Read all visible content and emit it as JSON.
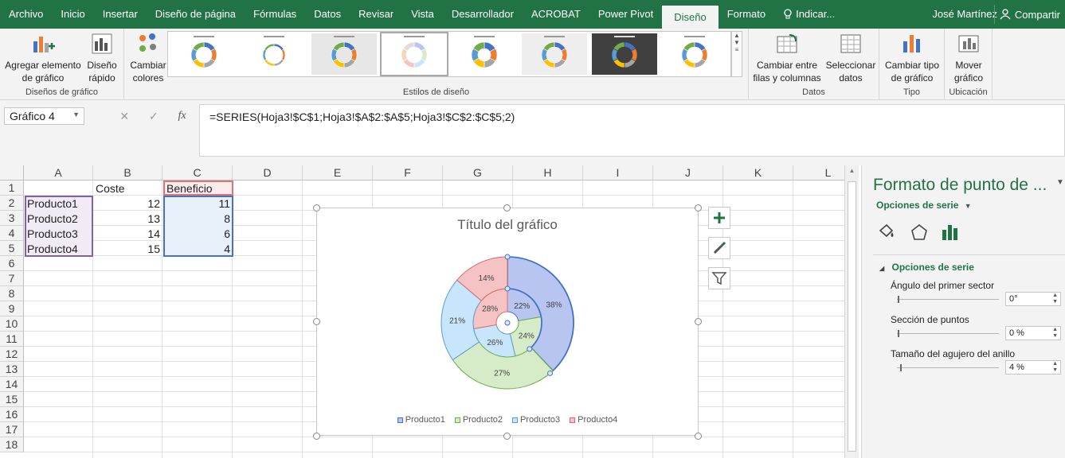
{
  "ribbon_tabs": [
    "Archivo",
    "Inicio",
    "Insertar",
    "Diseño de página",
    "Fórmulas",
    "Datos",
    "Revisar",
    "Vista",
    "Desarrollador",
    "ACROBAT",
    "Power Pivot",
    "Diseño",
    "Formato"
  ],
  "tell_me": "Indicar...",
  "user_name": "José Martínez",
  "share_label": "Compartir",
  "ribbon": {
    "add_element": "Agregar elemento",
    "add_element_2": "de gráfico",
    "quick_layout": "Diseño",
    "quick_layout_2": "rápido",
    "change_colors": "Cambiar",
    "change_colors_2": "colores",
    "group_layouts": "Diseños de gráfico",
    "group_styles": "Estilos de diseño",
    "switch_rows": "Cambiar entre",
    "switch_rows_2": "filas y columnas",
    "select_data": "Seleccionar",
    "select_data_2": "datos",
    "group_data": "Datos",
    "change_type": "Cambiar tipo",
    "change_type_2": "de gráfico",
    "group_type": "Tipo",
    "move_chart": "Mover",
    "move_chart_2": "gráfico",
    "group_location": "Ubicación"
  },
  "formula_bar": {
    "name_box": "Gráfico 4",
    "fx": "fx",
    "formula": "=SERIES(Hoja3!$C$1;Hoja3!$A$2:$A$5;Hoja3!$C$2:$C$5;2)"
  },
  "sheet": {
    "columns": [
      "A",
      "B",
      "C",
      "D",
      "E",
      "F",
      "G",
      "H",
      "I",
      "J",
      "K",
      "L"
    ],
    "rows": [
      "1",
      "2",
      "3",
      "4",
      "5",
      "6",
      "7",
      "8",
      "9",
      "10",
      "11",
      "12",
      "13",
      "14",
      "15",
      "16",
      "17",
      "18"
    ],
    "headers": {
      "B1": "Coste",
      "C1": "Beneficio"
    },
    "data": [
      {
        "a": "Producto1",
        "b": "12",
        "c": "11"
      },
      {
        "a": "Producto2",
        "b": "13",
        "c": "8"
      },
      {
        "a": "Producto3",
        "b": "14",
        "c": "6"
      },
      {
        "a": "Producto4",
        "b": "15",
        "c": "4"
      }
    ]
  },
  "chart_data": {
    "type": "doughnut",
    "title": "Título del gráfico",
    "categories": [
      "Producto1",
      "Producto2",
      "Producto3",
      "Producto4"
    ],
    "colors": [
      "#b7c5f0",
      "#d6ecc8",
      "#c8e6fb",
      "#f5c3c3"
    ],
    "strokes": [
      "#4472c4",
      "#70ad47",
      "#5b9bd5",
      "#e06666"
    ],
    "series": [
      {
        "name": "Coste",
        "values": [
          12,
          13,
          14,
          15
        ],
        "labels": [
          "22%",
          "24%",
          "26%",
          "28%"
        ]
      },
      {
        "name": "Beneficio",
        "values": [
          11,
          8,
          6,
          4
        ],
        "labels": [
          "38%",
          "27%",
          "21%",
          "14%"
        ]
      }
    ],
    "legend": "bottom"
  },
  "pane": {
    "title": "Formato de punto de ...",
    "series_options": "Opciones de serie",
    "section": "Opciones de serie",
    "angle_label": "Ángulo del primer sector",
    "angle_value": "0°",
    "explosion_label": "Sección de puntos",
    "explosion_value": "0 %",
    "hole_label": "Tamaño del agujero del anillo",
    "hole_value": "4 %"
  }
}
